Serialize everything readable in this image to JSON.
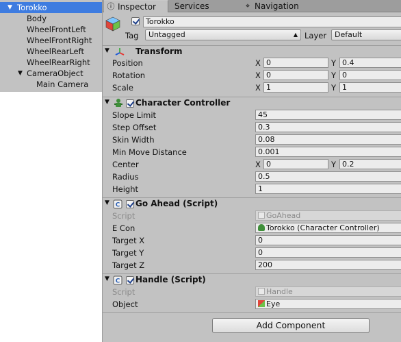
{
  "hierarchy": {
    "items": [
      {
        "label": "Torokko",
        "indent": 0,
        "expanded": true,
        "selected": true
      },
      {
        "label": "Body",
        "indent": 1
      },
      {
        "label": "WheelFrontLeft",
        "indent": 1
      },
      {
        "label": "WheelFrontRight",
        "indent": 1
      },
      {
        "label": "WheelRearLeft",
        "indent": 1
      },
      {
        "label": "WheelRearRight",
        "indent": 1
      },
      {
        "label": "CameraObject",
        "indent": 1,
        "expanded": true
      },
      {
        "label": "Main Camera",
        "indent": 2
      }
    ]
  },
  "tabs": {
    "inspector": "Inspector",
    "services": "Services",
    "navigation": "Navigation"
  },
  "object": {
    "name": "Torokko",
    "active": true,
    "tag_label": "Tag",
    "tag_value": "Untagged",
    "layer_label": "Layer",
    "layer_value": "Default"
  },
  "transform": {
    "title": "Transform",
    "position_label": "Position",
    "rotation_label": "Rotation",
    "scale_label": "Scale",
    "x_axis": "X",
    "y_axis": "Y",
    "position": {
      "x": "0",
      "y": "0.4"
    },
    "rotation": {
      "x": "0",
      "y": "0"
    },
    "scale": {
      "x": "1",
      "y": "1"
    }
  },
  "character_controller": {
    "title": "Character Controller",
    "enabled": true,
    "slope_limit_label": "Slope Limit",
    "slope_limit": "45",
    "step_offset_label": "Step Offset",
    "step_offset": "0.3",
    "skin_width_label": "Skin Width",
    "skin_width": "0.08",
    "min_move_label": "Min Move Distance",
    "min_move": "0.001",
    "center_label": "Center",
    "center": {
      "x": "0",
      "y": "0.2"
    },
    "radius_label": "Radius",
    "radius": "0.5",
    "height_label": "Height",
    "height": "1"
  },
  "go_ahead": {
    "title": "Go Ahead (Script)",
    "enabled": true,
    "script_label": "Script",
    "script_value": "GoAhead",
    "econ_label": "E Con",
    "econ_value": "Torokko (Character Controller)",
    "target_x_label": "Target X",
    "target_x": "0",
    "target_y_label": "Target Y",
    "target_y": "0",
    "target_z_label": "Target Z",
    "target_z": "200"
  },
  "handle": {
    "title": "Handle (Script)",
    "enabled": true,
    "script_label": "Script",
    "script_value": "Handle",
    "object_label": "Object",
    "object_value": "Eye"
  },
  "add_component": "Add Component",
  "colors": {
    "selection": "#3e7ce0",
    "panel": "#c2c2c2",
    "tabbar": "#9d9d9d"
  }
}
